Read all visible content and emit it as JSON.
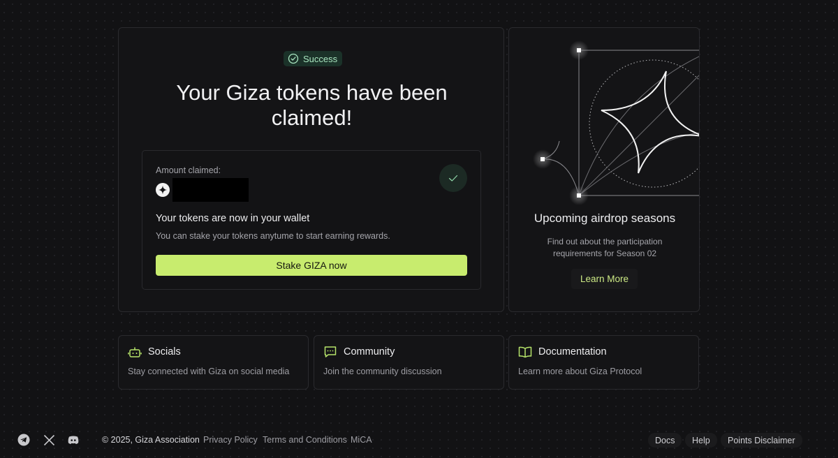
{
  "claim": {
    "badge": "Success",
    "headline": "Your Giza tokens have been claimed!",
    "amount_label": "Amount claimed:",
    "wallet_title": "Your tokens are now in your wallet",
    "wallet_subtitle": "You can stake your tokens anytume to start earning rewards.",
    "stake_button": "Stake GIZA now"
  },
  "airdrop": {
    "title": "Upcoming airdrop seasons",
    "subtitle": "Find out about the participation requirements for Season 02",
    "button": "Learn More"
  },
  "links": [
    {
      "icon": "robot-icon",
      "title": "Socials",
      "subtitle": "Stay connected with Giza on social media"
    },
    {
      "icon": "chat-bubble-icon",
      "title": "Community",
      "subtitle": "Join the community discussion"
    },
    {
      "icon": "book-icon",
      "title": "Documentation",
      "subtitle": "Learn more about Giza Protocol"
    }
  ],
  "footer": {
    "social_icons": [
      "telegram-icon",
      "x-icon",
      "discord-icon"
    ],
    "copyright": "© 2025, Giza Association",
    "links": [
      "Privacy Policy",
      "Terms and Conditions",
      "MiCA"
    ],
    "buttons": [
      "Docs",
      "Help",
      "Points Disclaimer"
    ]
  },
  "colors": {
    "background": "#121214",
    "card": "#141416",
    "accent": "#c8ec6e",
    "success_bg": "#1b3229",
    "success_text": "#a9e6c0",
    "icon_green": "#b6e46a"
  }
}
